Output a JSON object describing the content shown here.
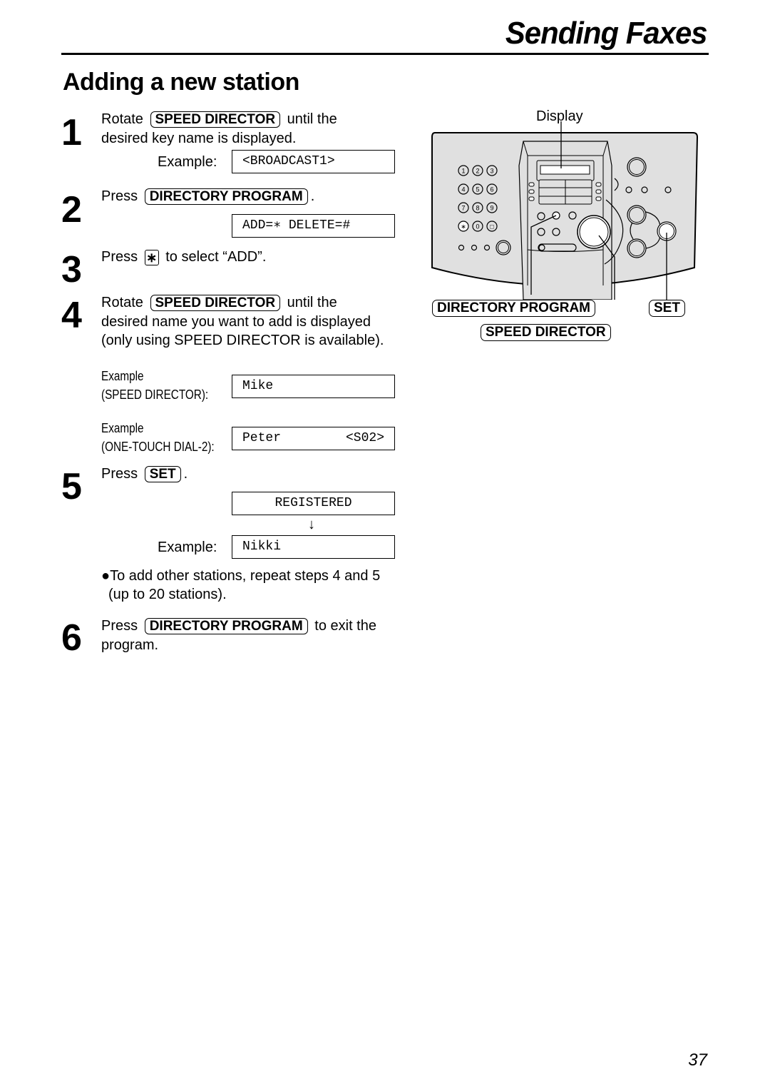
{
  "header": {
    "title": "Sending Faxes"
  },
  "section_title": "Adding a new station",
  "steps": [
    {
      "num": "1",
      "line1_pre": "Rotate",
      "key": "SPEED DIRECTOR",
      "line1_post": "until the",
      "line2": "desired key name is displayed.",
      "example_label": "Example:",
      "display": "<BROADCAST1>"
    },
    {
      "num": "2",
      "line1_pre": "Press",
      "key": "DIRECTORY PROGRAM",
      "line1_post": ".",
      "display": "ADD=∗ DELETE=#"
    },
    {
      "num": "3",
      "line1_pre": "Press",
      "key": "∗",
      "line1_post": "to select “ADD”."
    },
    {
      "num": "4",
      "line1_pre": "Rotate",
      "key": "SPEED DIRECTOR",
      "line1_post": "until the",
      "line2": "desired name you want to add is displayed",
      "line3": "(only using SPEED DIRECTOR is available).",
      "examples": [
        {
          "label1": "Example",
          "label2": "(SPEED DIRECTOR):",
          "display": "Mike"
        },
        {
          "label1": "Example",
          "label2": "(ONE-TOUCH DIAL-2):",
          "display_left": "Peter",
          "display_right": "<S02>"
        }
      ]
    },
    {
      "num": "5",
      "line1_pre": "Press",
      "key": "SET",
      "line1_post": ".",
      "display": "REGISTERED",
      "arrow": "↓",
      "example_label": "Example:",
      "display2": "Nikki",
      "note_line1": "●To add other stations, repeat steps 4 and 5",
      "note_line2": "(up to 20 stations)."
    },
    {
      "num": "6",
      "line1_pre": "Press",
      "key": "DIRECTORY PROGRAM",
      "line1_post": "to exit the",
      "line2": "program."
    }
  ],
  "diagram": {
    "display_label": "Display",
    "keypad": [
      "1",
      "2",
      "3",
      "4",
      "5",
      "6",
      "7",
      "8",
      "9",
      "∗",
      "0",
      "□"
    ],
    "labels": {
      "directory_program": "DIRECTORY PROGRAM",
      "set": "SET",
      "speed_director": "SPEED DIRECTOR"
    },
    "panel_color": "#e0e0e0"
  },
  "page_number": "37"
}
